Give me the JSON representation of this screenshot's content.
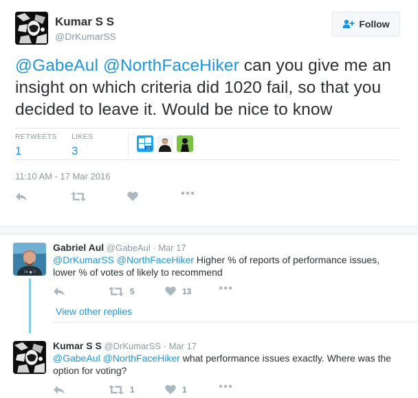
{
  "main_tweet": {
    "author_name": "Kumar S S",
    "author_handle": "@DrKumarSS",
    "follow_label": "Follow",
    "mention_1": "@GabeAul",
    "mention_2": "@NorthFaceHiker",
    "body": " can you give me an insight on which criteria did 1020 fail, so that you decided to leave it. Would be nice to know",
    "retweets_label": "RETWEETS",
    "retweets_value": "1",
    "likes_label": "LIKES",
    "likes_value": "3",
    "timestamp": "11:10 AM - 17 Mar 2016",
    "liker_avatars": [
      "windows-10-logo",
      "person-avatar",
      "green-silhouette-avatar"
    ]
  },
  "replies": [
    {
      "author_name": "Gabriel Aul",
      "author_handle": "@GabeAul",
      "date": "Mar 17",
      "mention_1": "@DrKumarSS",
      "mention_2": "@NorthFaceHiker",
      "body": " Higher % of reports of performance issues, lower % of votes of likely to recommend",
      "retweet_count": "5",
      "like_count": "13"
    },
    {
      "author_name": "Kumar S S",
      "author_handle": "@DrKumarSS",
      "date": "Mar 17",
      "mention_1": "@GabeAul",
      "mention_2": "@NorthFaceHiker",
      "body": " what performance issues exactly. Where was the option for voting?",
      "retweet_count": "1",
      "like_count": "1"
    }
  ],
  "view_other_replies": "View other replies",
  "colors": {
    "link": "#1b95e0",
    "text": "#292f33",
    "muted": "#8899a6",
    "icon": "#aab8c2",
    "thread": "#82c7ee"
  }
}
